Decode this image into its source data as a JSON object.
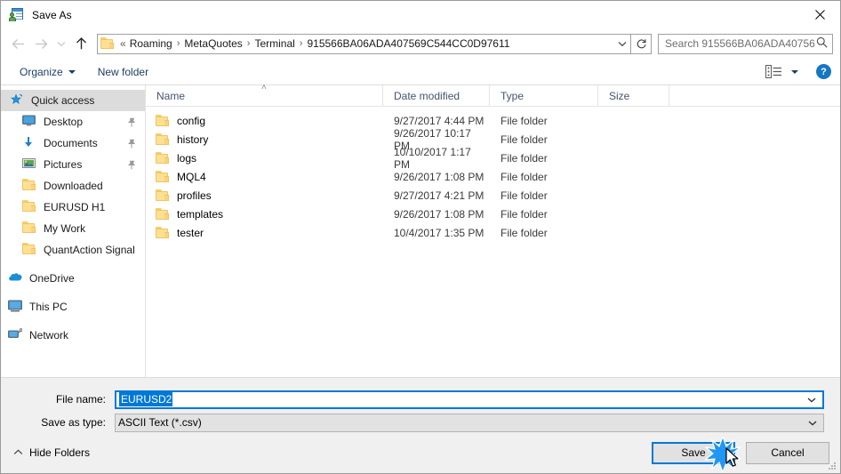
{
  "window": {
    "title": "Save As",
    "app_icon": "save-as-icon",
    "close_label": "✕"
  },
  "nav": {
    "back_icon": "back-arrow-icon",
    "forward_icon": "forward-arrow-icon",
    "recent_icon": "recent-locations-chevron-icon",
    "up_icon": "up-arrow-icon",
    "refresh_icon": "refresh-icon",
    "address_dropdown_icon": "chevron-down-icon",
    "breadcrumb_prefix": "«",
    "breadcrumbs": [
      "Roaming",
      "MetaQuotes",
      "Terminal",
      "915566BA06ADA407569C544CC0D97611"
    ],
    "breadcrumb_separator": "›"
  },
  "search": {
    "placeholder": "Search 915566BA06ADA40756...",
    "value": "",
    "icon": "search-icon"
  },
  "toolbar": {
    "organize_label": "Organize",
    "new_folder_label": "New folder",
    "view_icon": "view-layout-icon",
    "view_caret_icon": "chevron-down-icon",
    "help_label": "?"
  },
  "sidebar": {
    "items": [
      {
        "label": "Quick access",
        "icon": "star-pin-icon",
        "selected": true,
        "indent": false,
        "pinned": false,
        "group": false
      },
      {
        "label": "Desktop",
        "icon": "desktop-icon",
        "selected": false,
        "indent": true,
        "pinned": true,
        "group": false
      },
      {
        "label": "Documents",
        "icon": "documents-download-icon",
        "selected": false,
        "indent": true,
        "pinned": true,
        "group": false
      },
      {
        "label": "Pictures",
        "icon": "pictures-icon",
        "selected": false,
        "indent": true,
        "pinned": true,
        "group": false
      },
      {
        "label": "Downloaded",
        "icon": "folder-icon",
        "selected": false,
        "indent": true,
        "pinned": false,
        "group": false
      },
      {
        "label": "EURUSD H1",
        "icon": "folder-icon",
        "selected": false,
        "indent": true,
        "pinned": false,
        "group": false
      },
      {
        "label": "My Work",
        "icon": "folder-icon",
        "selected": false,
        "indent": true,
        "pinned": false,
        "group": false
      },
      {
        "label": "QuantAction Signal",
        "icon": "folder-icon",
        "selected": false,
        "indent": true,
        "pinned": false,
        "group": false
      },
      {
        "label": "OneDrive",
        "icon": "onedrive-cloud-icon",
        "selected": false,
        "indent": false,
        "pinned": false,
        "group": true
      },
      {
        "label": "This PC",
        "icon": "this-pc-icon",
        "selected": false,
        "indent": false,
        "pinned": false,
        "group": true
      },
      {
        "label": "Network",
        "icon": "network-icon",
        "selected": false,
        "indent": false,
        "pinned": false,
        "group": true
      }
    ],
    "pin_glyph": "📌"
  },
  "filelist": {
    "columns": [
      "Name",
      "Date modified",
      "Type",
      "Size"
    ],
    "sort_caret": "˄",
    "rows": [
      {
        "name": "config",
        "date": "9/27/2017 4:44 PM",
        "type": "File folder",
        "size": ""
      },
      {
        "name": "history",
        "date": "9/26/2017 10:17 PM",
        "type": "File folder",
        "size": ""
      },
      {
        "name": "logs",
        "date": "10/10/2017 1:17 PM",
        "type": "File folder",
        "size": ""
      },
      {
        "name": "MQL4",
        "date": "9/26/2017 1:08 PM",
        "type": "File folder",
        "size": ""
      },
      {
        "name": "profiles",
        "date": "9/27/2017 4:21 PM",
        "type": "File folder",
        "size": ""
      },
      {
        "name": "templates",
        "date": "9/26/2017 1:08 PM",
        "type": "File folder",
        "size": ""
      },
      {
        "name": "tester",
        "date": "10/4/2017 1:35 PM",
        "type": "File folder",
        "size": ""
      }
    ]
  },
  "form": {
    "filename_label": "File name:",
    "filename_value": "EURUSD2",
    "savetype_label": "Save as type:",
    "savetype_value": "ASCII Text (*.csv)",
    "dropdown_icon": "chevron-down-icon"
  },
  "footer": {
    "hide_folders_label": "Hide Folders",
    "hide_folders_icon": "chevron-up-icon",
    "save_label": "Save",
    "cancel_label": "Cancel",
    "resize_grip": "resize-grip-icon"
  },
  "colors": {
    "accent": "#0078d7",
    "folder_fill": "#fde093",
    "selection": "#dcdcdc",
    "chrome": "#f0f0f0"
  }
}
